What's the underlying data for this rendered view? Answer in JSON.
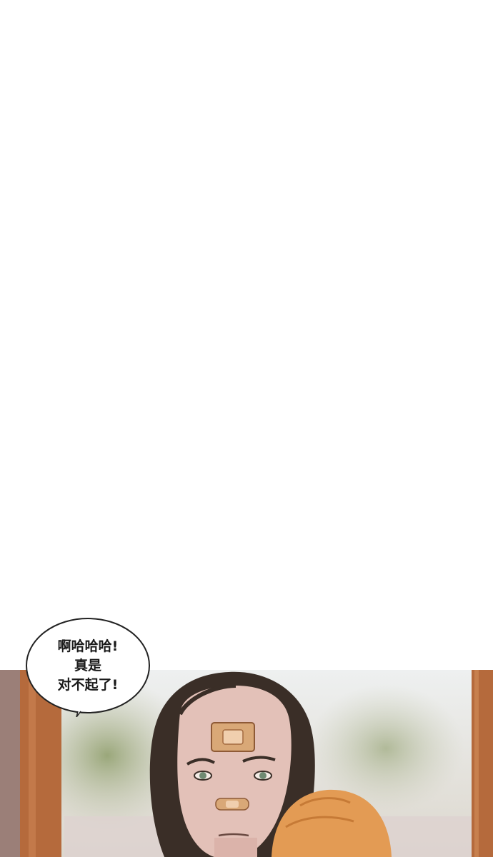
{
  "bubble": {
    "lines": [
      "啊哈哈哈!",
      "真是",
      "对不起了!"
    ]
  },
  "colors": {
    "background": "#ffffff",
    "frame_wood": "#b56a3c",
    "skin": "#e3c1b8",
    "hair": "#3a2e27",
    "bandage": "#d9a877",
    "child_hair": "#e39b54"
  }
}
